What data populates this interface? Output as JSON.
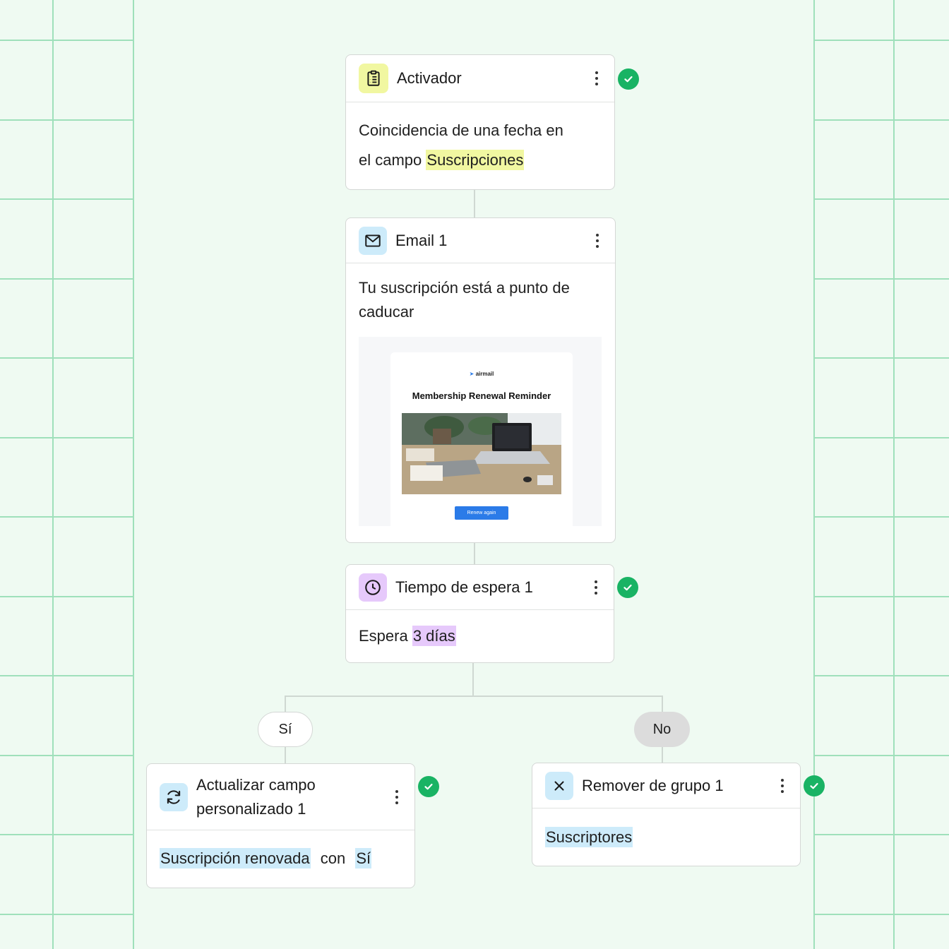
{
  "colors": {
    "background": "#effaf2",
    "grid": "#9fe0bb",
    "success": "#19b364",
    "highlight_yellow": "#f1f7a1",
    "highlight_purple": "#e6c9fb",
    "highlight_blue": "#cdebfa",
    "icon_trigger_bg": "#f1f7a1",
    "icon_email_bg": "#cdebfa",
    "icon_wait_bg": "#e6c9fb",
    "icon_update_bg": "#cdebfa",
    "icon_remove_bg": "#cdebfa",
    "button_blue": "#2b7be8"
  },
  "nodes": {
    "trigger": {
      "title": "Activador",
      "icon": "clipboard-icon",
      "text_line1": "Coincidencia de una fecha en",
      "text_line2_prefix": "el campo ",
      "field": "Suscripciones",
      "status": "check-circle-icon"
    },
    "email": {
      "title": "Email 1",
      "icon": "mail-icon",
      "subject_line1": "Tu suscripción está a punto de",
      "subject_line2": "caducar",
      "preview": {
        "brand": "airmail",
        "heading": "Membership Renewal Reminder",
        "button": "Renew again"
      }
    },
    "wait": {
      "title": "Tiempo de espera 1",
      "icon": "clock-icon",
      "text_prefix": "Espera ",
      "duration": "3 días",
      "status": "check-circle-icon"
    },
    "branch": {
      "yes_label": "Sí",
      "no_label": "No"
    },
    "update_field": {
      "title_line1": "Actualizar campo",
      "title_line2": "personalizado 1",
      "icon": "refresh-icon",
      "field": "Suscripción renovada",
      "connector": "con",
      "value": "Sí",
      "status": "check-circle-icon"
    },
    "remove_group": {
      "title": "Remover de grupo 1",
      "icon": "close-icon",
      "group": "Suscriptores",
      "status": "check-circle-icon"
    }
  }
}
